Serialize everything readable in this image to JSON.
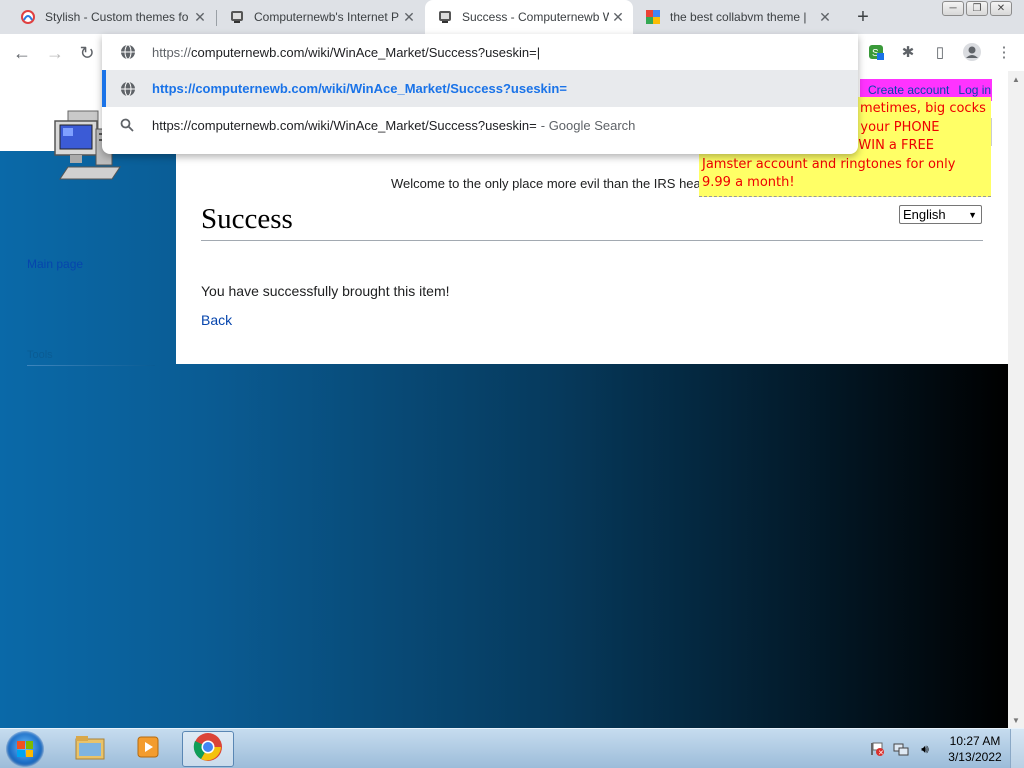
{
  "browser": {
    "tabs": [
      {
        "title": "Stylish - Custom themes fo",
        "favicon": "stylish-favicon",
        "active": false
      },
      {
        "title": "Computernewb's Internet P",
        "favicon": "computernewb-favicon",
        "active": false
      },
      {
        "title": "Success - Computernewb W",
        "favicon": "computernewb-favicon",
        "active": true
      },
      {
        "title": "the best collabvm theme | ",
        "favicon": "google-sites-favicon",
        "active": false
      }
    ],
    "omnibox": {
      "typed_prefix": "https://",
      "typed_rest": "computernewb.com/wiki/WinAce_Market/Success?useskin=",
      "suggestion_url": "https://computernewb.com/wiki/WinAce_Market/Success?useskin=",
      "suggestion_search": "https://computernewb.com/wiki/WinAce_Market/Success?useskin=",
      "suggestion_search_hint": "- Google Search"
    }
  },
  "wiki": {
    "personal": {
      "create_account": "Create account",
      "login": "Log in"
    },
    "welcome": "Welcome to the only place more evil than the IRS headquarters - Oops!",
    "title": "Success",
    "language": "English",
    "message": "You have successfully brought this item!",
    "back": "Back",
    "sidebar": {
      "main_page": "Main page",
      "tools_heading": "Tools"
    },
    "ad": {
      "line1": "metimes, big cocks",
      "line2": "n your PHONE",
      "line3": "d WIN a FREE",
      "line4": "Jamster account and ringtones for only",
      "line5": "9.99 a month!"
    }
  },
  "taskbar": {
    "time": "10:27 AM",
    "date": "3/13/2022"
  },
  "colors": {
    "accent": "#1a73e8",
    "link": "#0645ad",
    "ad_bg": "#ffff66",
    "ad_text": "#ee0000",
    "personal_bg": "#ff33ff"
  }
}
